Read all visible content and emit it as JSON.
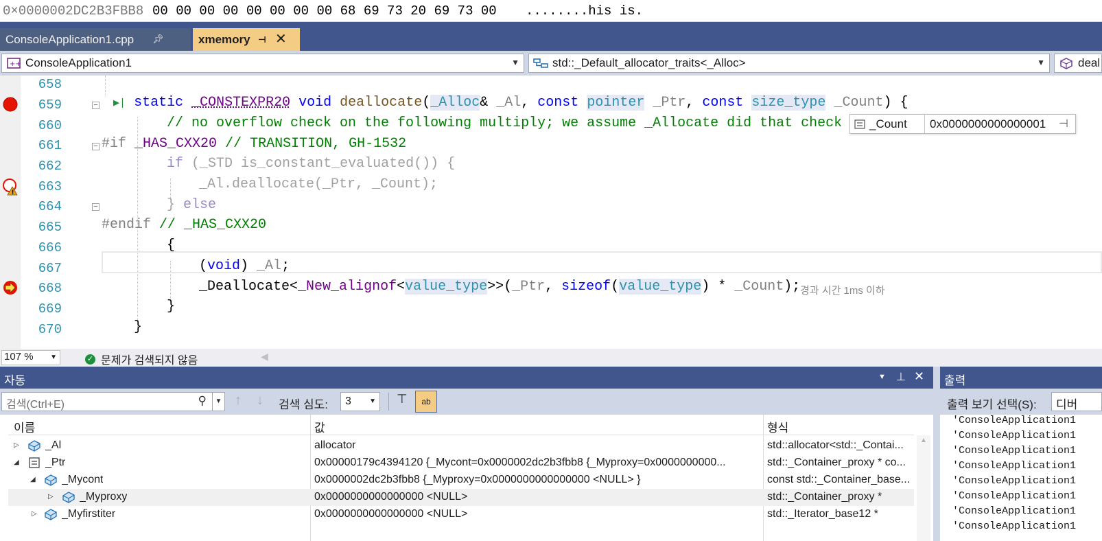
{
  "memory": {
    "address": "0×0000002DC2B3FBB8",
    "bytes": "00 00 00 00 00 00 00 00 68 69 73 20 69 73 00",
    "ascii": "........his is."
  },
  "tabs": [
    {
      "label": "ConsoleApplication1.cpp",
      "active": false
    },
    {
      "label": "xmemory",
      "active": true
    }
  ],
  "nav": {
    "project": "ConsoleApplication1",
    "scope": "std::_Default_allocator_traits<_Alloc>",
    "member": "deal"
  },
  "editor": {
    "line_numbers": [
      "658",
      "659",
      "660",
      "661",
      "662",
      "663",
      "664",
      "665",
      "666",
      "667",
      "668",
      "669",
      "670"
    ],
    "perf_tip": "경과 시간 1ms 이하"
  },
  "datatip": {
    "name": "_Count",
    "value": "0x0000000000000001"
  },
  "status": {
    "zoom": "107 %",
    "issues": "문제가 검색되지 않음"
  },
  "autos": {
    "title": "자동",
    "search_placeholder": "검색(Ctrl+E)",
    "depth_label": "검색 심도:",
    "depth_value": "3",
    "columns": [
      "이름",
      "값",
      "형식"
    ],
    "rows": [
      {
        "name": "_Al",
        "value": "allocator",
        "type": "std::allocator<std::_Contai...",
        "level": 0,
        "expander": "▷",
        "icon": "object-icon"
      },
      {
        "name": "_Ptr",
        "value": "0x00000179c4394120 {_Mycont=0x0000002dc2b3fbb8 {_Myproxy=0x0000000000...",
        "type": "std::_Container_proxy * co...",
        "level": 0,
        "expander": "◢",
        "icon": "pointer-icon"
      },
      {
        "name": "_Mycont",
        "value": "0x0000002dc2b3fbb8 {_Myproxy=0x0000000000000000 <NULL> }",
        "type": "const std::_Container_base...",
        "level": 1,
        "expander": "◢",
        "icon": "object-icon"
      },
      {
        "name": "_Myproxy",
        "value": "0x0000000000000000 <NULL>",
        "type": "std::_Container_proxy *",
        "level": 2,
        "expander": "▷",
        "icon": "object-icon"
      },
      {
        "name": "_Myfirstiter",
        "value": "0x0000000000000000 <NULL>",
        "type": "std::_Iterator_base12 *",
        "level": 1,
        "expander": "▷",
        "icon": "object-icon"
      }
    ]
  },
  "output": {
    "title": "출력",
    "source_label": "출력 보기 선택(S):",
    "source_value": "디버",
    "lines": [
      "'ConsoleApplication1",
      "'ConsoleApplication1",
      "'ConsoleApplication1",
      "'ConsoleApplication1",
      "'ConsoleApplication1",
      "'ConsoleApplication1",
      "'ConsoleApplication1",
      "'ConsoleApplication1"
    ]
  },
  "colors": {
    "title_bar": "#40568d",
    "active_tab": "#f5cc84",
    "breakpoint": "#e51400",
    "keyword": "#0000ff",
    "type": "#2b91af",
    "comment": "#008000"
  }
}
